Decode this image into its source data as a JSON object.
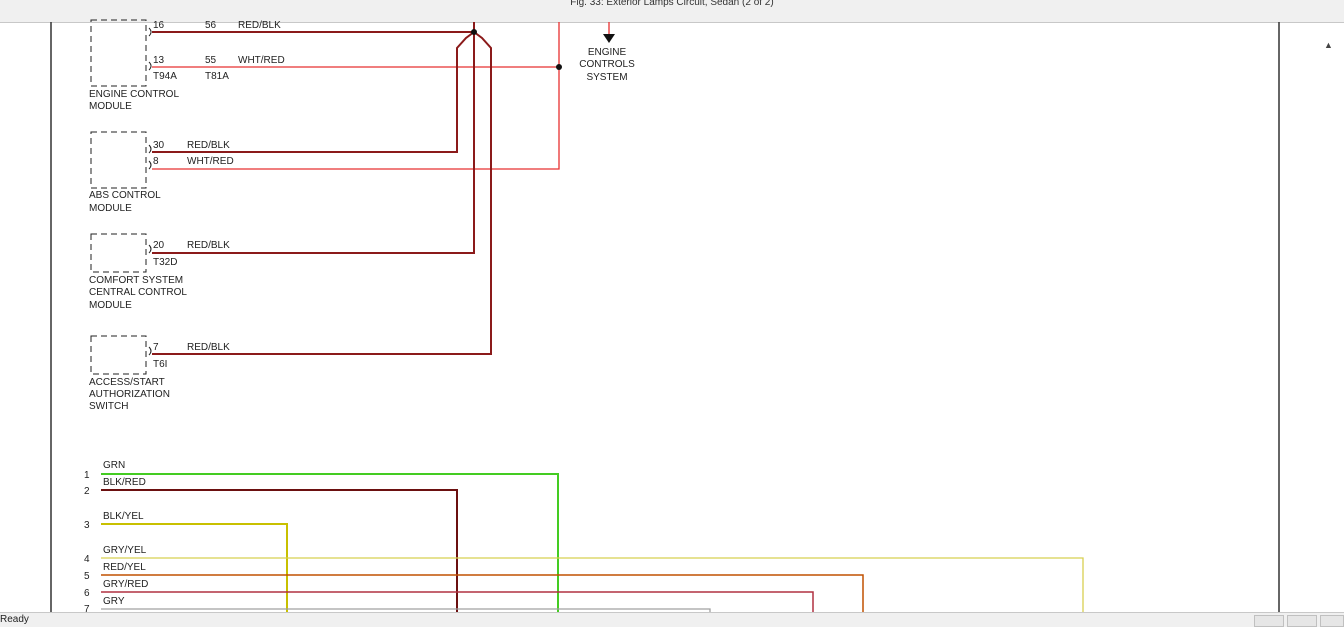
{
  "window": {
    "title": "Fig. 33: Exterior Lamps Circuit, Sedan (2 of 2)",
    "status": "Ready"
  },
  "colors": {
    "red_blk": "#8b1a1a",
    "wht_red": "#e83030",
    "grn": "#44cc22",
    "blk_red": "#6b1010",
    "blk_yel": "#c8c000",
    "gry_yel": "#d8d050",
    "red_yel": "#c05000",
    "gry_red": "#b03040",
    "gry": "#a0a0a0"
  },
  "modules": [
    {
      "id": "ecm",
      "name_lines": [
        "ENGINE CONTROL",
        "MODULE"
      ],
      "connector_top": "T94A",
      "connector_bottom": "T81A"
    },
    {
      "id": "abs",
      "name_lines": [
        "ABS CONTROL",
        "MODULE"
      ],
      "connector": ""
    },
    {
      "id": "comfort",
      "name_lines": [
        "COMFORT SYSTEM",
        "CENTRAL CONTROL",
        "MODULE"
      ],
      "connector": "T32D"
    },
    {
      "id": "access",
      "name_lines": [
        "ACCESS/START",
        "AUTHORIZATION",
        "SWITCH"
      ],
      "connector": "T6I"
    }
  ],
  "wires": [
    {
      "id": "ecm-16",
      "pins": [
        "16",
        "56"
      ],
      "label": "RED/BLK"
    },
    {
      "id": "ecm-13",
      "pins": [
        "13",
        "55"
      ],
      "label": "WHT/RED"
    },
    {
      "id": "abs-30",
      "pins": [
        "30"
      ],
      "label": "RED/BLK"
    },
    {
      "id": "abs-8",
      "pins": [
        "8"
      ],
      "label": "WHT/RED"
    },
    {
      "id": "comfort-20",
      "pins": [
        "20"
      ],
      "label": "RED/BLK"
    },
    {
      "id": "access-7",
      "pins": [
        "7"
      ],
      "label": "RED/BLK"
    }
  ],
  "engine_controls": {
    "lines": [
      "ENGINE",
      "CONTROLS",
      "SYSTEM"
    ]
  },
  "bus": [
    {
      "pin": "1",
      "label": "GRN"
    },
    {
      "pin": "2",
      "label": "BLK/RED"
    },
    {
      "pin": "3",
      "label": "BLK/YEL"
    },
    {
      "pin": "4",
      "label": "GRY/YEL"
    },
    {
      "pin": "5",
      "label": "RED/YEL"
    },
    {
      "pin": "6",
      "label": "GRY/RED"
    },
    {
      "pin": "7",
      "label": "GRY"
    }
  ]
}
